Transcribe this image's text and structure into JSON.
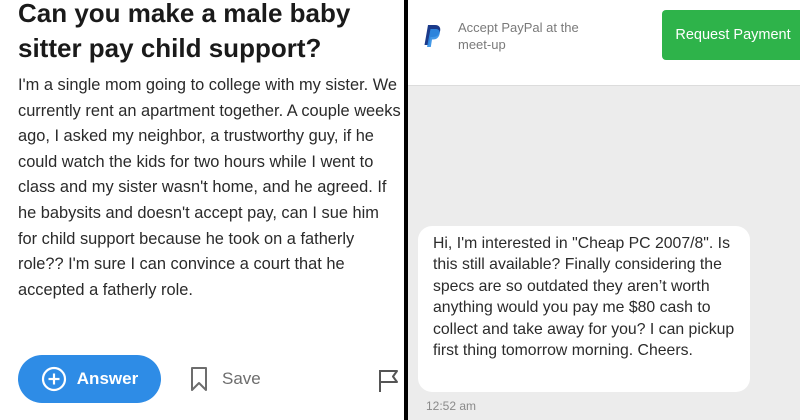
{
  "question": {
    "title": "Can you make a male baby sitter pay child support?",
    "body": "I'm a single mom going to college with my sister. We currently rent an apartment together. A couple weeks ago, I asked my neighbor, a trustworthy guy, if he could watch the kids for two hours while I went to class and my sister wasn't home, and he agreed. If he babysits and doesn't accept pay, can I sue him for child support because he took on a fatherly role?? I'm sure I can convince a court that he accepted a fatherly role."
  },
  "actions": {
    "answer_label": "Answer",
    "save_label": "Save",
    "icons": {
      "answer": "plus-circle-icon",
      "save": "bookmark-icon",
      "report": "flag-icon"
    }
  },
  "chat": {
    "paypal_text": "Accept PayPal at the meet-up",
    "paypal_icon": "paypal-icon",
    "request_button_label": "Request Payment",
    "message": "Hi, I'm interested in \"Cheap PC 2007/8\". Is this still available? Finally considering the specs are so outdated they aren’t worth anything would you pay me $80 cash to collect and take away for you? I can pickup first thing tomorrow morning. Cheers.",
    "timestamp": "12:52 am"
  },
  "colors": {
    "answer_button": "#2e8ce6",
    "request_button": "#2eb34a",
    "chat_background": "#ececec",
    "paypal_dark": "#1b3a8a",
    "paypal_light": "#2f8de4"
  }
}
